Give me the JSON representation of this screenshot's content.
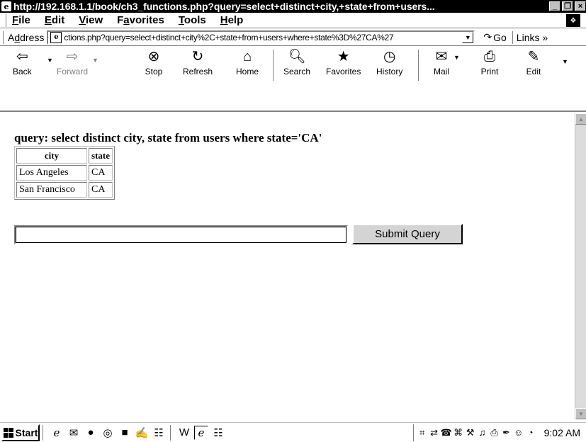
{
  "window": {
    "title": "http://192.168.1.1/book/ch3_functions.php?query=select+distinct+city,+state+from+users...",
    "minimize": "_",
    "restore": "̸",
    "close": "×"
  },
  "menu": {
    "items": [
      {
        "key": "F",
        "rest": "ile"
      },
      {
        "key": "E",
        "rest": "dit"
      },
      {
        "key": "V",
        "rest": "iew"
      },
      {
        "key": "a",
        "pre": "F",
        "rest": "vorites"
      },
      {
        "key": "T",
        "rest": "ools"
      },
      {
        "key": "H",
        "rest": "elp"
      }
    ]
  },
  "address": {
    "label_pre": "A",
    "label_key": "d",
    "label_rest": "dress",
    "url": "ctions.php?query=select+distinct+city%2C+state+from+users+where+state%3D%27CA%27",
    "go_label": "Go",
    "links_label": "Links »"
  },
  "toolbar": {
    "back": "Back",
    "forward": "Forward",
    "stop": "Stop",
    "refresh": "Refresh",
    "home": "Home",
    "search": "Search",
    "favorites": "Favorites",
    "history": "History",
    "mail": "Mail",
    "print": "Print",
    "edit": "Edit"
  },
  "page": {
    "heading": "query: select distinct city, state from users where state='CA'",
    "table": {
      "headers": [
        "city",
        "state"
      ],
      "rows": [
        [
          "Los Angeles",
          "CA"
        ],
        [
          "San Francisco",
          "CA"
        ]
      ]
    },
    "input_value": "",
    "submit_label": "Submit Query"
  },
  "taskbar": {
    "start_label": "Start",
    "clock": "9:02 AM"
  }
}
